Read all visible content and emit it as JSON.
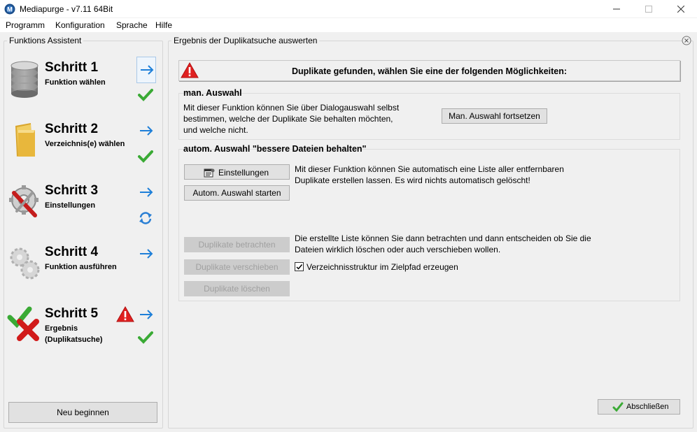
{
  "window": {
    "title": "Mediapurge - v7.11 64Bit",
    "minimize_label": "—",
    "maximize_label": "☐",
    "close_label": "✕"
  },
  "menu": [
    {
      "label": "Programm"
    },
    {
      "label": "Konfiguration"
    },
    {
      "label": "Sprache"
    },
    {
      "label": "Hilfe"
    }
  ],
  "assistant": {
    "title": "Funktions Assistent",
    "steps": [
      {
        "title": "Schritt 1",
        "subtitle": "Funktion wählen",
        "icon": "database-icon",
        "status": "done"
      },
      {
        "title": "Schritt 2",
        "subtitle": "Verzeichnis(e) wählen",
        "icon": "folder-icon",
        "status": "done"
      },
      {
        "title": "Schritt 3",
        "subtitle": "Einstellungen",
        "icon": "settings-tools-icon",
        "status": "refresh"
      },
      {
        "title": "Schritt 4",
        "subtitle": "Funktion ausführen",
        "icon": "gears-icon",
        "status": "none"
      },
      {
        "title": "Schritt 5",
        "subtitle_line1": "Ergebnis",
        "subtitle_line2": "(Duplikatsuche)",
        "icon": "check-cross-icon",
        "status": "done",
        "warning": true
      }
    ],
    "restart_button": "Neu beginnen"
  },
  "result": {
    "title": "Ergebnis der Duplikatsuche auswerten",
    "banner": "Duplikate gefunden, wählen Sie eine der folgenden Möglichkeiten:",
    "manual": {
      "title": "man. Auswahl",
      "text_line1": "Mit dieser Funktion können Sie über Dialogauswahl selbst",
      "text_line2": "bestimmen, welche der Duplikate Sie behalten möchten,",
      "text_line3": "und welche nicht.",
      "button": "Man. Auswahl fortsetzen"
    },
    "auto": {
      "title": "autom. Auswahl \"bessere Dateien behalten\"",
      "settings_button": "Einstellungen",
      "start_button": "Autom. Auswahl starten",
      "text_line1": "Mit dieser Funktion können Sie automatisch eine Liste aller  entfernbaren",
      "text_line2": "Duplikate erstellen lassen. Es wird nichts automatisch gelöscht!",
      "view_button": "Duplikate betrachten",
      "move_button": "Duplikate verschieben",
      "delete_button": "Duplikate löschen",
      "list_text_line1": "Die erstellte Liste können Sie dann betrachten und dann entscheiden ob Sie die",
      "list_text_line2": "Dateien wirklich löschen oder auch verschieben wollen.",
      "checkbox_label": "Verzeichnisstruktur im Zielpfad erzeugen",
      "checkbox_checked": true
    },
    "finish_button": "Abschließen"
  },
  "colors": {
    "arrow": "#1e7fd8",
    "check": "#3aaa35",
    "warning": "#e02020"
  }
}
